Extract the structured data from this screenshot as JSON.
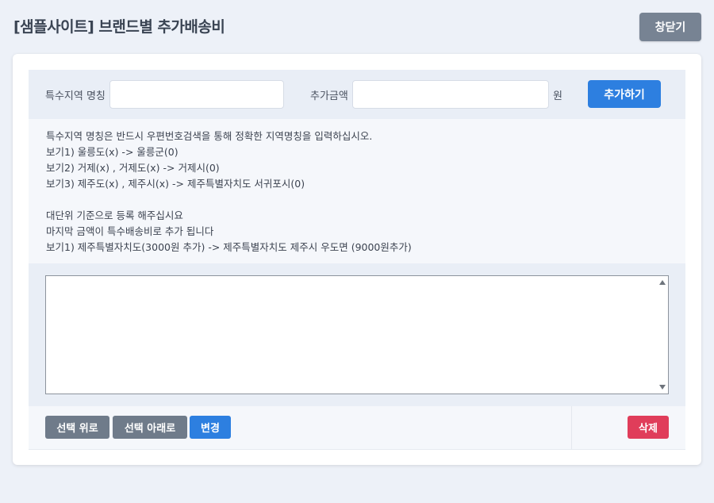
{
  "header": {
    "title": "[샘플사이트] 브랜드별 추가배송비",
    "close_label": "창닫기"
  },
  "form": {
    "region_label": "특수지역 명칭",
    "region_value": "",
    "amount_label": "추가금액",
    "amount_value": "",
    "currency_unit": "원",
    "add_label": "추가하기"
  },
  "help": {
    "lines": [
      "특수지역 명칭은 반드시 우편번호검색을 통해 정확한 지역명칭을 입력하십시오.",
      "보기1) 울릉도(x) -> 울릉군(0)",
      "보기2) 거제(x) , 거제도(x) -> 거제시(0)",
      "보기3) 제주도(x) , 제주시(x) -> 제주특별자치도 서귀포시(0)",
      "",
      "대단위 기준으로 등록 해주십시요",
      "마지막 금액이 특수배송비로 추가 됩니다",
      "보기1) 제주특별자치도(3000원 추가) -> 제주특별자치도 제주시 우도면 (9000원추가)"
    ]
  },
  "list": {
    "items": []
  },
  "actions": {
    "move_up_label": "선택 위로",
    "move_down_label": "선택 아래로",
    "edit_label": "변경",
    "delete_label": "삭제"
  },
  "colors": {
    "primary": "#2d7fe0",
    "secondary": "#6f7b8a",
    "danger": "#e03d5a",
    "background": "#edf1f8"
  }
}
